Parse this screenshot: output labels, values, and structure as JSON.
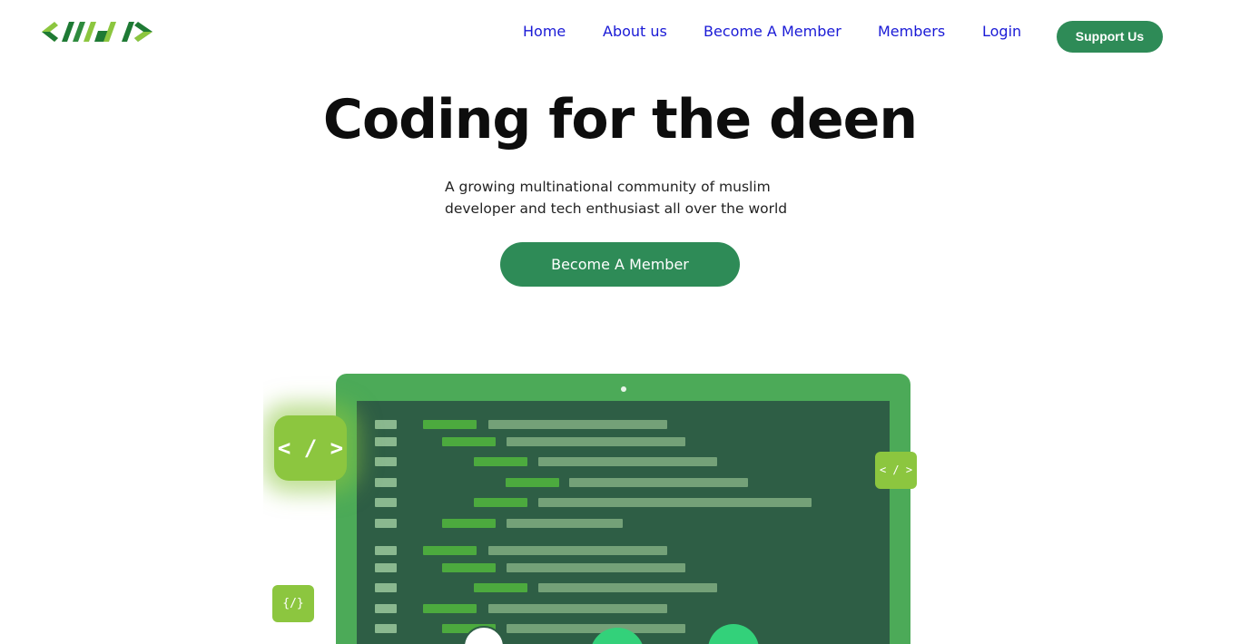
{
  "brand": {
    "logo_icon": "mdi-code-logo",
    "colors": {
      "dark_green": "#1e7a34",
      "light_green": "#8cc63f",
      "accent": "#2e8b57",
      "link": "#1a1ad6"
    }
  },
  "nav": {
    "items": [
      {
        "label": "Home"
      },
      {
        "label": "About us"
      },
      {
        "label": "Become A Member"
      },
      {
        "label": "Members"
      },
      {
        "label": "Login"
      }
    ],
    "support_label": "Support Us"
  },
  "hero": {
    "title": "Coding for the deen",
    "subtitle_line1": "A growing multinational community of muslim",
    "subtitle_line2": "developer and tech enthusiast all over the world",
    "cta_label": "Become A Member"
  },
  "illustration": {
    "badge_main": "< / >",
    "badge_right": "< / >",
    "badge_left": "{/}"
  }
}
